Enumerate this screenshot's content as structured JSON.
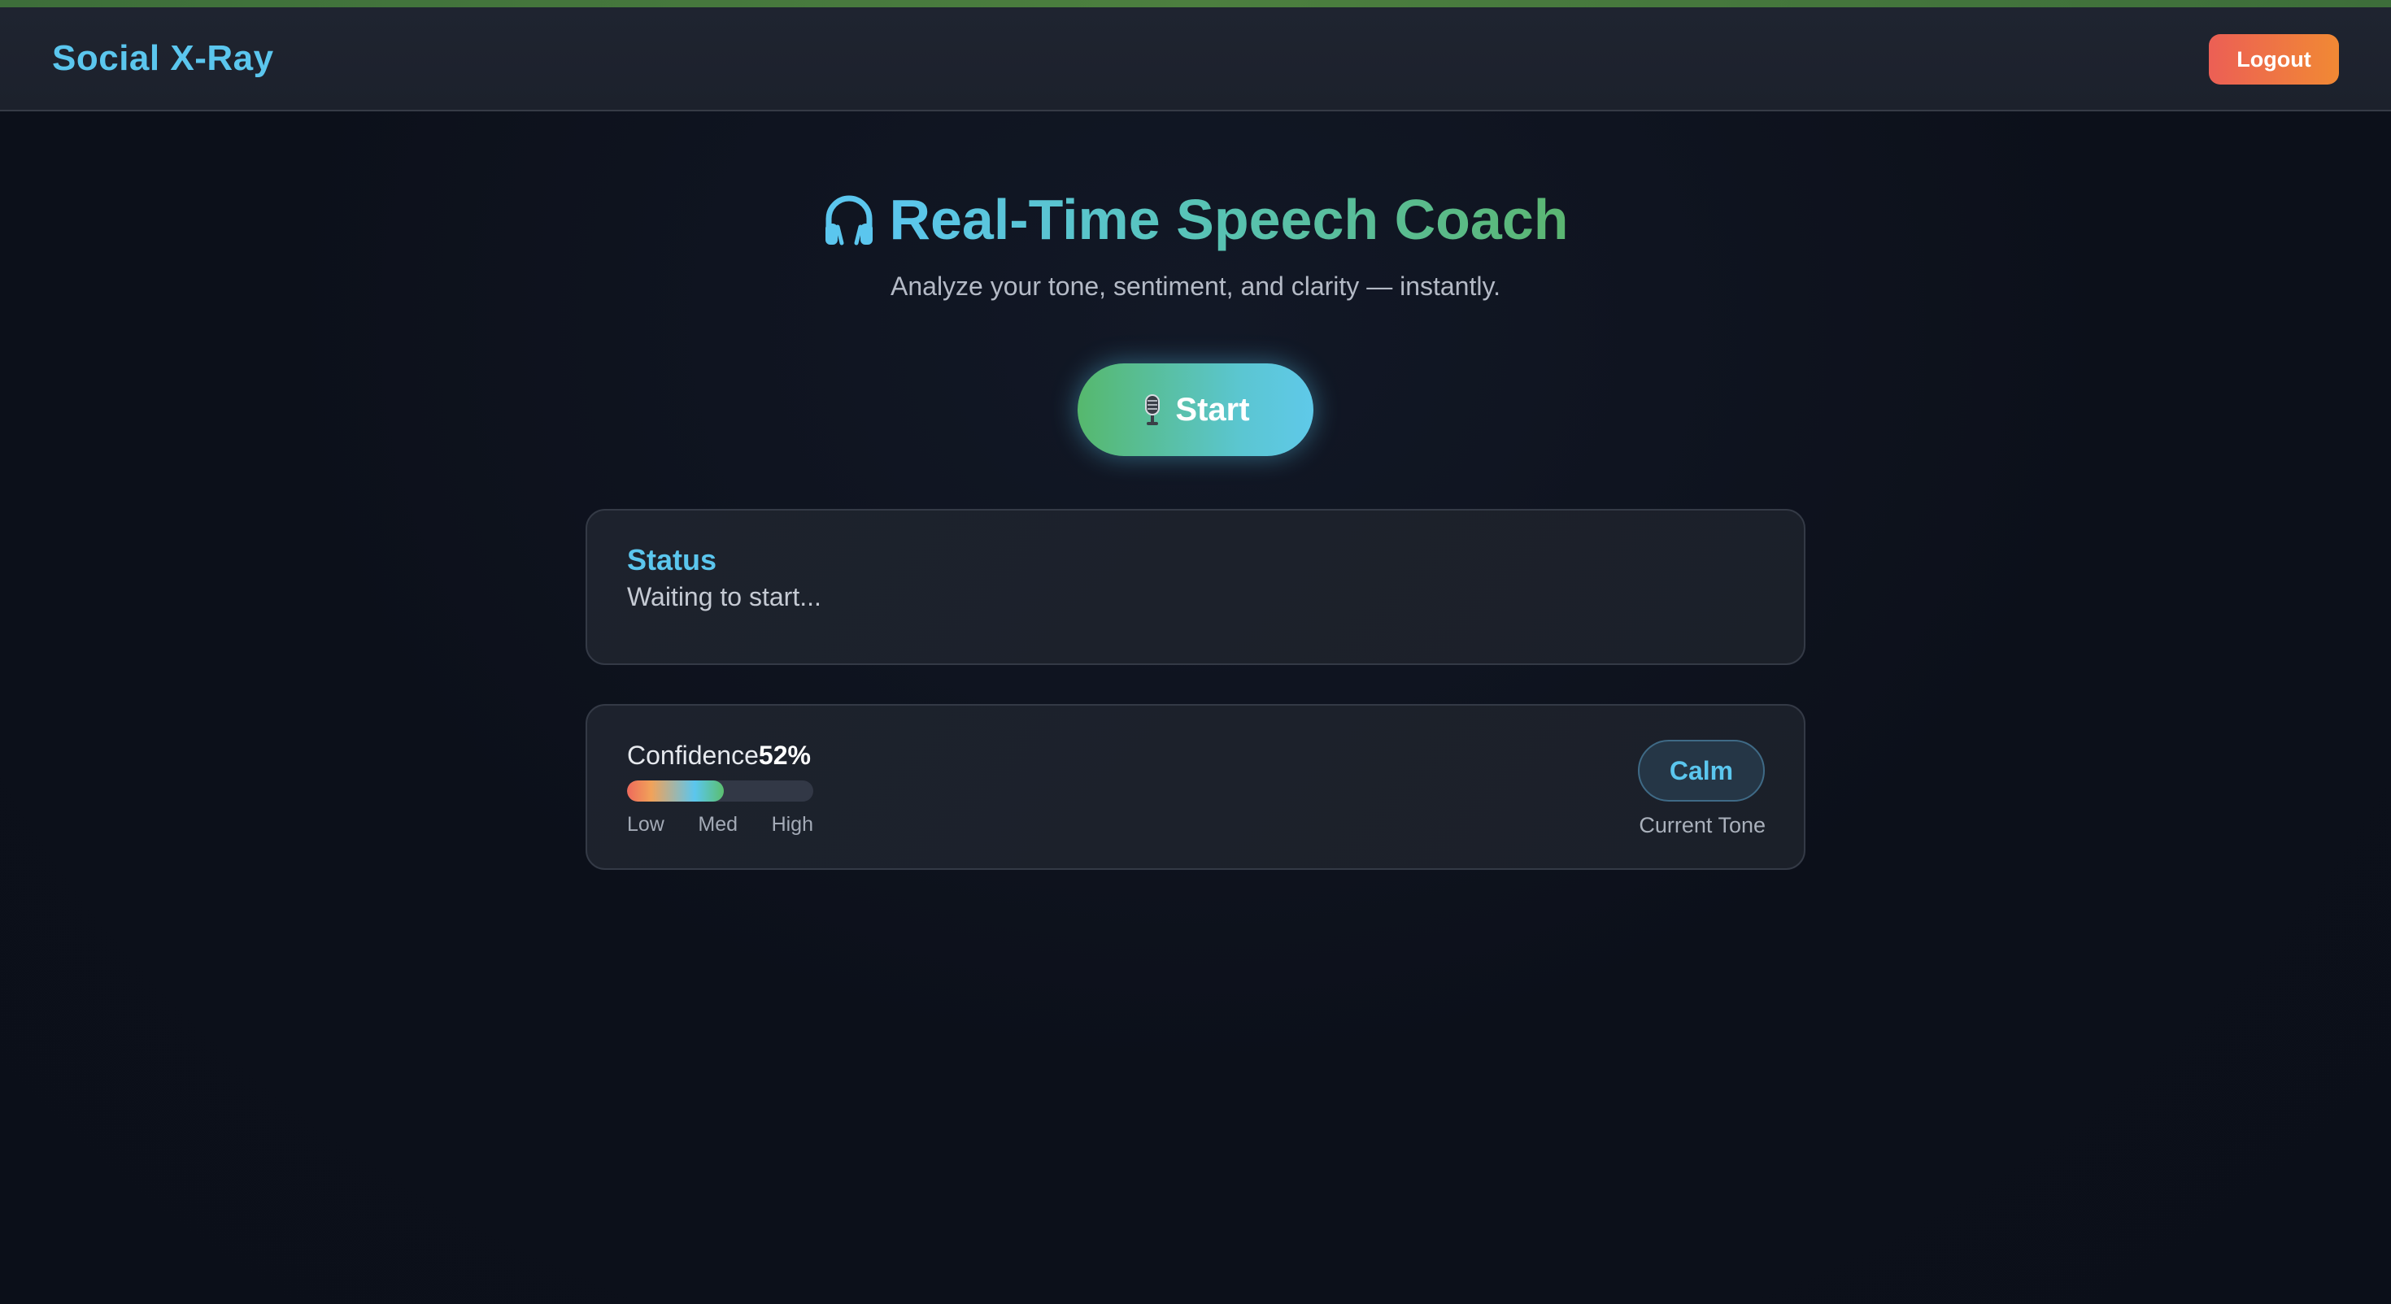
{
  "header": {
    "brand": "Social X-Ray",
    "logout_label": "Logout"
  },
  "hero": {
    "icon": "headphones-icon",
    "title": "Real-Time Speech Coach",
    "subtitle": "Analyze your tone, sentiment, and clarity — instantly."
  },
  "start_button": {
    "icon": "microphone-icon",
    "label": "Start"
  },
  "status": {
    "title": "Status",
    "text": "Waiting to start..."
  },
  "metrics": {
    "confidence_label": "Confidence",
    "confidence_value": "52%",
    "confidence_level": 0.52,
    "scale": [
      "Low",
      "Med",
      "High"
    ],
    "tone": "Calm",
    "tone_caption": "Current Tone"
  },
  "colors": {
    "accent_blue": "#5bc6ee",
    "accent_green": "#5bb671",
    "logout_gradient": [
      "#ec5f55",
      "#f18934"
    ],
    "background": "#0d111b"
  }
}
